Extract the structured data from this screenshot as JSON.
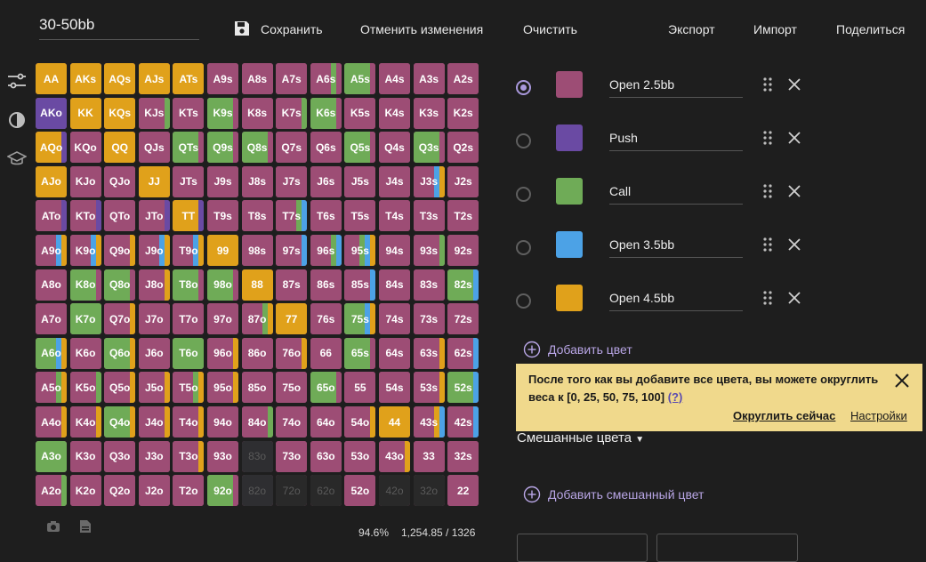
{
  "range_name": "30-50bb",
  "toolbar": {
    "save_label": "Сохранить",
    "undo_label": "Отменить изменения",
    "clear_label": "Очистить",
    "export_label": "Экспорт",
    "import_label": "Импорт",
    "share_label": "Поделиться"
  },
  "sidebar": {
    "icons": [
      "sliders-icon",
      "contrast-icon",
      "graduation-cap-icon"
    ]
  },
  "colors": [
    {
      "name": "Open 2.5bb",
      "hex": "#9d4d75",
      "selected": true
    },
    {
      "name": "Push",
      "hex": "#6a4aa3",
      "selected": false
    },
    {
      "name": "Call",
      "hex": "#6fab57",
      "selected": false
    },
    {
      "name": "Open 3.5bb",
      "hex": "#4ca2e6",
      "selected": false
    },
    {
      "name": "Open 4.5bb",
      "hex": "#e0a11b",
      "selected": false
    }
  ],
  "add_color_label": "Добавить цвет",
  "notice": {
    "text": "После того как вы добавите все цвета, вы можете округлить веса к [0, 25, 50, 75, 100]",
    "help": "(?)",
    "round_now": "Округлить сейчас",
    "settings": "Настройки"
  },
  "mixed_colors_label": "Смешанные цвета",
  "add_mixed_label": "Добавить смешанный цвет",
  "stats": {
    "percent": "94.6%",
    "combos": "1,254.85 / 1326"
  },
  "grid": {
    "ranks": [
      "A",
      "K",
      "Q",
      "J",
      "T",
      "9",
      "8",
      "7",
      "6",
      "5",
      "4",
      "3",
      "2"
    ],
    "palette": {
      "O": "#e0a11b",
      "P": "#9d4d75",
      "U": "#6a4aa3",
      "G": "#6fab57",
      "B": "#4ca2e6",
      "D": "#2e2e31",
      "E": "#292929"
    },
    "rows": [
      [
        "O",
        "O",
        "O",
        "O",
        "O",
        "P",
        "P",
        "P",
        "P|G|P",
        "G|P",
        "P",
        "P",
        "P"
      ],
      [
        "U",
        "O",
        "O",
        "P|G",
        "P",
        "G|P",
        "P",
        "P|G",
        "G|P",
        "P",
        "P",
        "P",
        "P"
      ],
      [
        "O|U",
        "P",
        "O",
        "P",
        "G|P",
        "G|P",
        "G|P",
        "P",
        "P",
        "G|P",
        "P",
        "G|P",
        "P"
      ],
      [
        "O",
        "P",
        "P",
        "O",
        "P",
        "P",
        "P",
        "P",
        "P",
        "P",
        "P",
        "P|B|O",
        "P"
      ],
      [
        "P|U",
        "P|U",
        "P",
        "P|U",
        "O|U",
        "P",
        "P",
        "P|G|B",
        "P",
        "P",
        "P",
        "P",
        "P"
      ],
      [
        "P|B|O",
        "P|B|O",
        "P|O",
        "P|B|O",
        "P|B|O",
        "O",
        "P",
        "P|B",
        "P|G|B",
        "P|G|B|O",
        "P",
        "P|G",
        "P"
      ],
      [
        "P",
        "G|P",
        "G|P",
        "P|O",
        "G|P",
        "G|P",
        "O",
        "P",
        "P",
        "P|B",
        "P",
        "P",
        "G|B"
      ],
      [
        "P",
        "G",
        "P|O",
        "P",
        "P",
        "P",
        "P|G|O",
        "O",
        "P",
        "G|B|O",
        "P",
        "P",
        "P"
      ],
      [
        "G|B|O",
        "P",
        "G|O",
        "P",
        "G",
        "P|O",
        "P",
        "P|O",
        "P",
        "G|P",
        "P",
        "P|O",
        "P|B"
      ],
      [
        "P|G|O",
        "P|G",
        "P|O",
        "P|O",
        "P|G|O",
        "P|O",
        "P",
        "P",
        "G|P",
        "P",
        "P",
        "P|O",
        "G|B"
      ],
      [
        "P|O",
        "P|O",
        "G|O",
        "P|O",
        "P|O",
        "P",
        "P|G",
        "P",
        "P",
        "P|O",
        "O",
        "P|O|B",
        "P|B"
      ],
      [
        "G",
        "P",
        "P",
        "P",
        "P|O",
        "P",
        "D",
        "P",
        "P",
        "P",
        "P|O",
        "P",
        "P"
      ],
      [
        "P|G",
        "P",
        "P",
        "P",
        "P",
        "G|P",
        "D",
        "E",
        "E",
        "P",
        "E",
        "E",
        "P"
      ]
    ]
  }
}
